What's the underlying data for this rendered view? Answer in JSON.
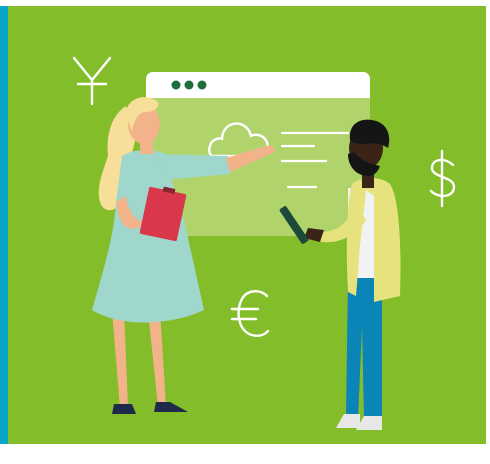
{
  "colors": {
    "accent_bar": "#0aa6c8",
    "background": "#84bd2a",
    "browser_window": "#b1d36b",
    "browser_titlebar": "#ffffff",
    "window_dots": "#1c6f3a",
    "line_art": "#ffffff",
    "woman_dress": "#9fd7cc",
    "woman_hair": "#f7df9a",
    "skin_light": "#f3b38a",
    "clipboard": "#d9374a",
    "man_jacket": "#e6e27e",
    "man_trousers": "#0b84b8",
    "man_skin": "#3a2418",
    "man_hair": "#151515",
    "shoes_dark": "#1f2a4a",
    "shoes_light": "#e8e8e8",
    "tablet": "#1b4a3a"
  },
  "icons": [
    "yen-icon",
    "dollar-icon",
    "euro-icon",
    "cloud-icon"
  ]
}
